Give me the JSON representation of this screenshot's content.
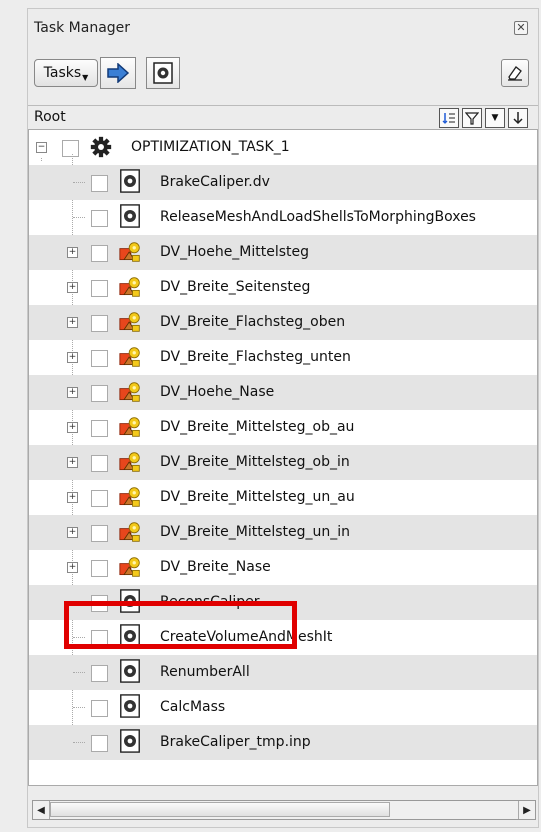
{
  "window": {
    "title": "Task Manager"
  },
  "toolbar": {
    "tasks_label": "Tasks"
  },
  "header": {
    "root_label": "Root"
  },
  "root_node": {
    "label": "OPTIMIZATION_TASK_1",
    "icon": "gear-icon"
  },
  "tree_items": [
    {
      "label": "BrakeCaliper.dv",
      "icon": "script-gear-icon",
      "expandable": false
    },
    {
      "label": "ReleaseMeshAndLoadShellsToMorphingBoxes",
      "icon": "script-gear-icon",
      "expandable": false
    },
    {
      "label": "DV_Hoehe_Mittelsteg",
      "icon": "design-variable-icon",
      "expandable": true
    },
    {
      "label": "DV_Breite_Seitensteg",
      "icon": "design-variable-icon",
      "expandable": true
    },
    {
      "label": "DV_Breite_Flachsteg_oben",
      "icon": "design-variable-icon",
      "expandable": true
    },
    {
      "label": "DV_Breite_Flachsteg_unten",
      "icon": "design-variable-icon",
      "expandable": true
    },
    {
      "label": "DV_Hoehe_Nase",
      "icon": "design-variable-icon",
      "expandable": true
    },
    {
      "label": "DV_Breite_Mittelsteg_ob_au",
      "icon": "design-variable-icon",
      "expandable": true
    },
    {
      "label": "DV_Breite_Mittelsteg_ob_in",
      "icon": "design-variable-icon",
      "expandable": true
    },
    {
      "label": "DV_Breite_Mittelsteg_un_au",
      "icon": "design-variable-icon",
      "expandable": true
    },
    {
      "label": "DV_Breite_Mittelsteg_un_in",
      "icon": "design-variable-icon",
      "expandable": true
    },
    {
      "label": "DV_Breite_Nase",
      "icon": "design-variable-icon",
      "expandable": true
    },
    {
      "label": "ReconsCaliper",
      "icon": "script-gear-icon",
      "expandable": false,
      "highlighted": true
    },
    {
      "label": "CreateVolumeAndMeshIt",
      "icon": "script-gear-icon",
      "expandable": false
    },
    {
      "label": "RenumberAll",
      "icon": "script-gear-icon",
      "expandable": false
    },
    {
      "label": "CalcMass",
      "icon": "script-gear-icon",
      "expandable": false
    },
    {
      "label": "BrakeCaliper_tmp.inp",
      "icon": "script-gear-icon",
      "expandable": false
    }
  ],
  "colors": {
    "highlight": "#e00000",
    "row_alt": "#e4e4e4"
  }
}
